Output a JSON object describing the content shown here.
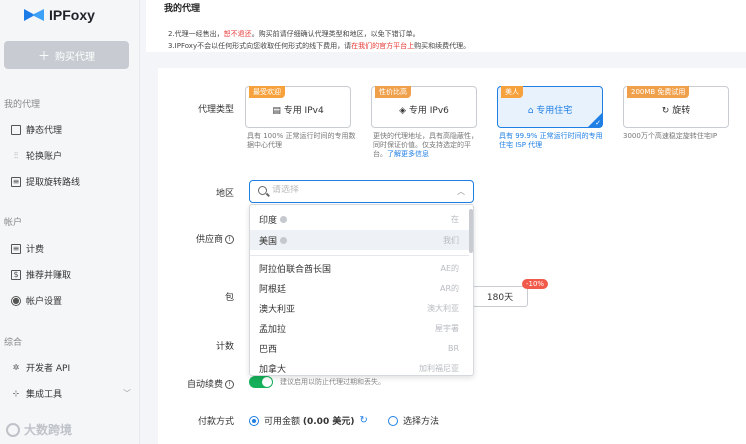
{
  "brand": {
    "name": "IPFoxy"
  },
  "sidebar": {
    "buy_label": "购买代理",
    "groups": [
      {
        "title": "我的代理",
        "items": [
          {
            "label": "静态代理",
            "icon": "static-proxy-icon"
          },
          {
            "label": "轮换账户",
            "icon": "rotating-account-icon"
          },
          {
            "label": "提取旋转路线",
            "icon": "extract-route-icon"
          }
        ]
      },
      {
        "title": "帐户",
        "items": [
          {
            "label": "计费",
            "icon": "billing-icon"
          },
          {
            "label": "推荐并赚取",
            "icon": "referral-icon"
          },
          {
            "label": "帐户设置",
            "icon": "account-settings-icon"
          }
        ]
      },
      {
        "title": "综合",
        "items": [
          {
            "label": "开发者 API",
            "icon": "developer-api-icon"
          },
          {
            "label": "集成工具",
            "icon": "integration-tools-icon"
          }
        ]
      }
    ],
    "watermark": "大数跨境"
  },
  "header": {
    "title": "我的代理",
    "notices": [
      {
        "prefix": "2.代理一经售出，",
        "red": "恕不退还",
        "suffix": "。购买前请仔细确认代理类型和地区，以免下错订单。"
      },
      {
        "prefix": "3.IPFoxy不会以任何形式向您收取任何形式的线下费用，请",
        "red": "在我们的官方平台上",
        "suffix": "购买和续费代理。"
      }
    ]
  },
  "form": {
    "proxy_type_label": "代理类型",
    "region_label": "地区",
    "supplier_label": "供应商",
    "package_label": "包",
    "count_label": "计数",
    "auto_renew_label": "自动续费",
    "payment_label": "付款方式"
  },
  "proxy_types": [
    {
      "tag": "最受欢迎",
      "name": "专用 IPv4",
      "icon": "list-icon",
      "desc": "具有 100% 正常运行时间的专用数据中心代理"
    },
    {
      "tag": "性价比高",
      "name": "专用 IPv6",
      "icon": "layers-icon",
      "desc": "更快的代理地址，具有高隐蔽性，同时保证价值。仅支持选定的平台。",
      "link": "了解更多信息"
    },
    {
      "tag": "美人",
      "name": "专用住宅",
      "icon": "home-icon",
      "desc": "具有 99.9% 正常运行时间的专用住宅 ISP 代理",
      "selected": true
    },
    {
      "tag": "200MB 免费试用",
      "name": "旋转",
      "icon": "rotate-icon",
      "desc": "3000万个高速稳定旋转住宅IP"
    }
  ],
  "region": {
    "placeholder": "请选择",
    "options": [
      {
        "label": "印度",
        "alt": "在",
        "badge": true
      },
      {
        "label": "美国",
        "alt": "我们",
        "badge": true,
        "active": true
      },
      {
        "label": "阿拉伯联合酋长国",
        "alt": "AE的"
      },
      {
        "label": "阿根廷",
        "alt": "AR的"
      },
      {
        "label": "澳大利亚",
        "alt": "澳大利亚"
      },
      {
        "label": "孟加拉",
        "alt": "屋宇署"
      },
      {
        "label": "巴西",
        "alt": "BR"
      },
      {
        "label": "加拿大",
        "alt": "加利福尼亚"
      }
    ]
  },
  "package": {
    "duration": "180天",
    "discount": "-10%"
  },
  "auto_renew": {
    "on": true,
    "hint": "建议启用以防止代理过期和丢失。"
  },
  "payment": {
    "options": [
      {
        "label": "可用金额",
        "amount": "(0.00 美元)",
        "checked": true
      },
      {
        "label": "选择方法",
        "checked": false
      }
    ]
  },
  "colors": {
    "accent": "#1f7fe5",
    "toggle": "#16b05a",
    "warning": "#e53935",
    "discount": "#f15a4a"
  }
}
